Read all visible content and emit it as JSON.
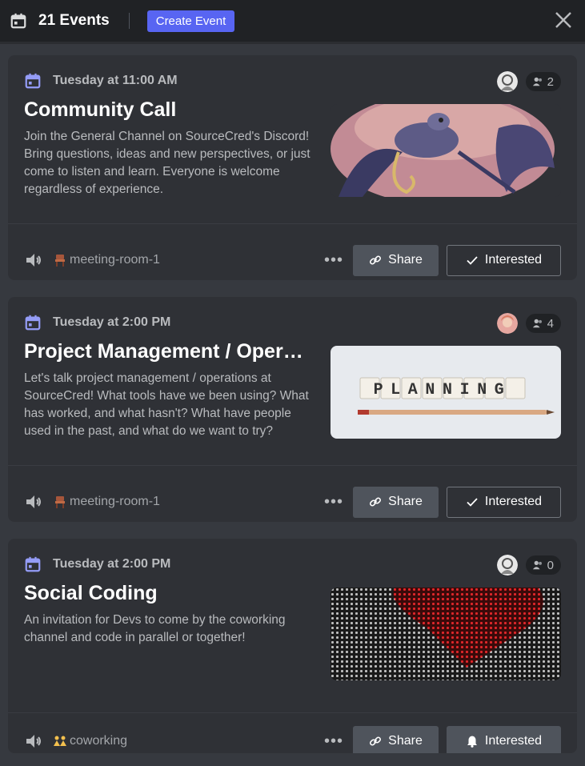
{
  "header": {
    "count_label": "21 Events",
    "create_label": "Create Event"
  },
  "events": [
    {
      "date": "Tuesday at 11:00 AM",
      "title": "Community Call",
      "description": "Join the General Channel on SourceCred's Discord! Bring questions, ideas and new perspectives, or just come to listen and learn. Everyone is welcome regardless of experience.",
      "attendees": "2",
      "channel": "meeting-room-1",
      "share_label": "Share",
      "interested_label": "Interested"
    },
    {
      "date": "Tuesday at 2:00 PM",
      "title": "Project Management / Operations",
      "description": "Let's talk project management / operations at SourceCred! What tools have we been using? What has worked, and what hasn't? What have people used in the past, and what do we want to try?",
      "attendees": "4",
      "channel": "meeting-room-1",
      "share_label": "Share",
      "interested_label": "Interested",
      "image_text": "PLANNING"
    },
    {
      "date": "Tuesday at 2:00 PM",
      "title": "Social Coding",
      "description": "An invitation for Devs to come by the coworking channel and code in parallel or together!",
      "attendees": "0",
      "channel": "coworking",
      "share_label": "Share",
      "interested_label": "Interested"
    }
  ],
  "colors": {
    "accent": "#5865f2",
    "calendar_icon": "#949cf7",
    "background": "#36393f",
    "card": "#2f3136"
  }
}
